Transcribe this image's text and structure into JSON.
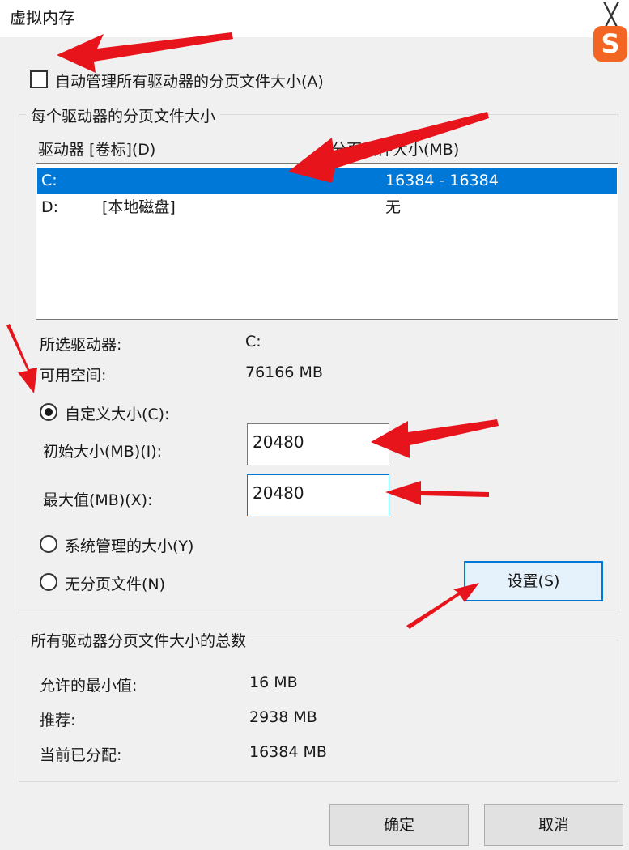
{
  "window": {
    "title": "虚拟内存",
    "close_glyph": "╳"
  },
  "ime": {
    "logo_text": "S"
  },
  "auto_manage": {
    "label": "自动管理所有驱动器的分页文件大小(A)",
    "checked": false
  },
  "per_drive": {
    "group_title": "每个驱动器的分页文件大小",
    "columns": [
      "驱动器 [卷标](D)",
      "分页文件大小(MB)"
    ],
    "drives": [
      {
        "drive": "C:",
        "label": "",
        "size": "16384 - 16384",
        "selected": true
      },
      {
        "drive": "D:",
        "label": "[本地磁盘]",
        "size": "无",
        "selected": false
      }
    ],
    "selected_drive_label": "所选驱动器:",
    "selected_drive_value": "C:",
    "free_space_label": "可用空间:",
    "free_space_value": "76166 MB",
    "custom_size": {
      "label": "自定义大小(C):",
      "initial_label": "初始大小(MB)(I):",
      "initial_value": "20480",
      "max_label": "最大值(MB)(X):",
      "max_value": "20480"
    },
    "system_managed_label": "系统管理的大小(Y)",
    "no_paging_label": "无分页文件(N)",
    "set_button": "设置(S)"
  },
  "totals": {
    "group_title": "所有驱动器分页文件大小的总数",
    "min_label": "允许的最小值:",
    "min_value": "16 MB",
    "recommended_label": "推荐:",
    "recommended_value": "2938 MB",
    "current_label": "当前已分配:",
    "current_value": "16384 MB"
  },
  "buttons": {
    "ok": "确定",
    "cancel": "取消"
  },
  "annotation_color": "#e8141c"
}
